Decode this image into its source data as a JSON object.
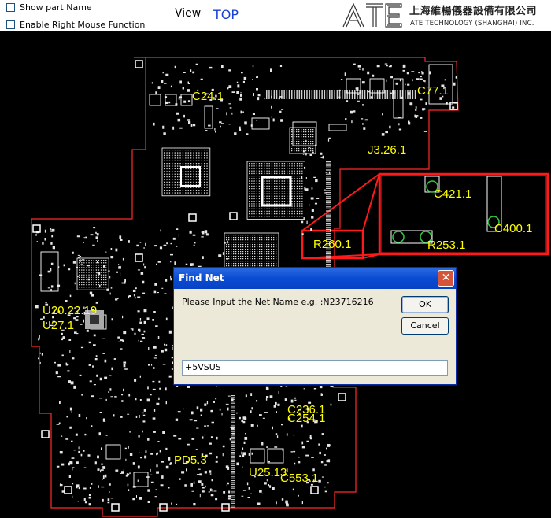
{
  "toolbar": {
    "show_part_name": {
      "label": "Show part Name",
      "checked": false
    },
    "enable_right_mouse": {
      "label": "Enable Right Mouse Function",
      "checked": false
    },
    "view_label": "View",
    "view_value": "TOP",
    "logo_text": "ATE",
    "company_cn": "上海維楊儀器設備有限公司",
    "company_en": "ATE TECHNOLOGY (SHANGHAI) INC."
  },
  "board": {
    "parts": [
      {
        "name": "C24.1"
      },
      {
        "name": "C77.1"
      },
      {
        "name": "J3.26.1"
      },
      {
        "name": "C421.1"
      },
      {
        "name": "C400.1"
      },
      {
        "name": "R253.1"
      },
      {
        "name": "R260.1"
      },
      {
        "name": "U20.22.19"
      },
      {
        "name": "U27.1"
      },
      {
        "name": "C236.1"
      },
      {
        "name": "C254.1"
      },
      {
        "name": "PD5.3"
      },
      {
        "name": "U25.13"
      },
      {
        "name": "C553.1"
      }
    ],
    "colors": {
      "background": "#000000",
      "outline": "#ff2020",
      "label": "#ffff00",
      "trace": "#ffffff"
    }
  },
  "dialog": {
    "title": "Find Net",
    "prompt": "Please Input the Net Name e.g. :N23716216",
    "ok_label": "OK",
    "cancel_label": "Cancel",
    "input_value": "+5VSUS",
    "close_icon": "close-icon"
  }
}
